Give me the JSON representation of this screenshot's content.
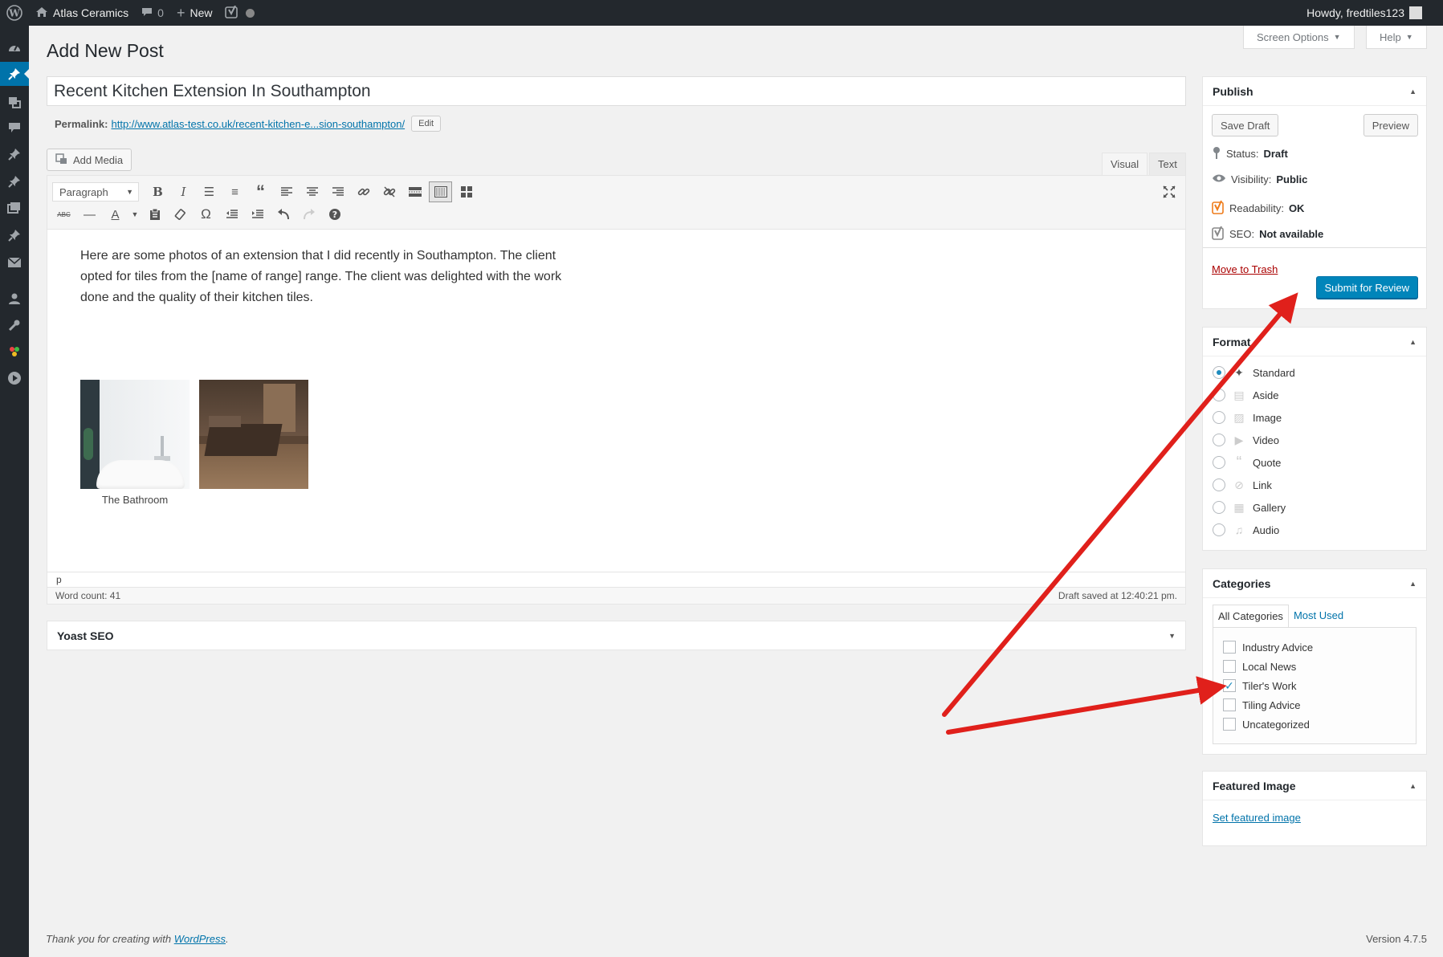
{
  "adminbar": {
    "site_name": "Atlas Ceramics",
    "comments_count": "0",
    "new_label": "New",
    "howdy": "Howdy, fredtiles123"
  },
  "header": {
    "page_title": "Add New Post",
    "screen_options": "Screen Options",
    "help": "Help"
  },
  "post": {
    "title": "Recent Kitchen Extension In Southampton",
    "permalink_label": "Permalink:",
    "permalink_url": "http://www.atlas-test.co.uk/recent-kitchen-e...sion-southampton/",
    "edit_label": "Edit"
  },
  "editor": {
    "add_media": "Add Media",
    "tab_visual": "Visual",
    "tab_text": "Text",
    "format_select": "Paragraph",
    "content": "Here are some photos of an extension that I did recently in Southampton. The client opted for tiles from the [name of range] range. The client was delighted with the work done and the quality of their kitchen tiles.",
    "caption": "The Bathroom",
    "path": "p",
    "word_count": "Word count: 41",
    "draft_saved": "Draft saved at 12:40:21 pm."
  },
  "yoast": {
    "title": "Yoast SEO"
  },
  "publish": {
    "title": "Publish",
    "save_draft": "Save Draft",
    "preview": "Preview",
    "status_label": "Status:",
    "status_value": "Draft",
    "visibility_label": "Visibility:",
    "visibility_value": "Public",
    "readability_label": "Readability:",
    "readability_value": "OK",
    "seo_label": "SEO:",
    "seo_value": "Not available",
    "trash": "Move to Trash",
    "submit": "Submit for Review"
  },
  "format": {
    "title": "Format",
    "items": [
      {
        "label": "Standard",
        "icon": "pin-icon",
        "selected": true
      },
      {
        "label": "Aside",
        "icon": "aside-icon",
        "selected": false
      },
      {
        "label": "Image",
        "icon": "image-icon",
        "selected": false
      },
      {
        "label": "Video",
        "icon": "video-icon",
        "selected": false
      },
      {
        "label": "Quote",
        "icon": "quote-icon",
        "selected": false
      },
      {
        "label": "Link",
        "icon": "link-icon",
        "selected": false
      },
      {
        "label": "Gallery",
        "icon": "gallery-icon",
        "selected": false
      },
      {
        "label": "Audio",
        "icon": "audio-icon",
        "selected": false
      }
    ]
  },
  "categories": {
    "title": "Categories",
    "tab_all": "All Categories",
    "tab_most_used": "Most Used",
    "items": [
      {
        "label": "Industry Advice",
        "checked": false
      },
      {
        "label": "Local News",
        "checked": false
      },
      {
        "label": "Tiler's Work",
        "checked": true
      },
      {
        "label": "Tiling Advice",
        "checked": false
      },
      {
        "label": "Uncategorized",
        "checked": false
      }
    ]
  },
  "featured_image": {
    "title": "Featured Image",
    "set_link": "Set featured image"
  },
  "footer": {
    "thanks_prefix": "Thank you for creating with ",
    "wordpress_link": "WordPress",
    "thanks_suffix": ".",
    "version": "Version 4.7.5"
  },
  "colors": {
    "admin_dark": "#23282d",
    "accent": "#0073aa",
    "primary_button": "#0085ba",
    "annotation_arrow": "#e0201b"
  }
}
